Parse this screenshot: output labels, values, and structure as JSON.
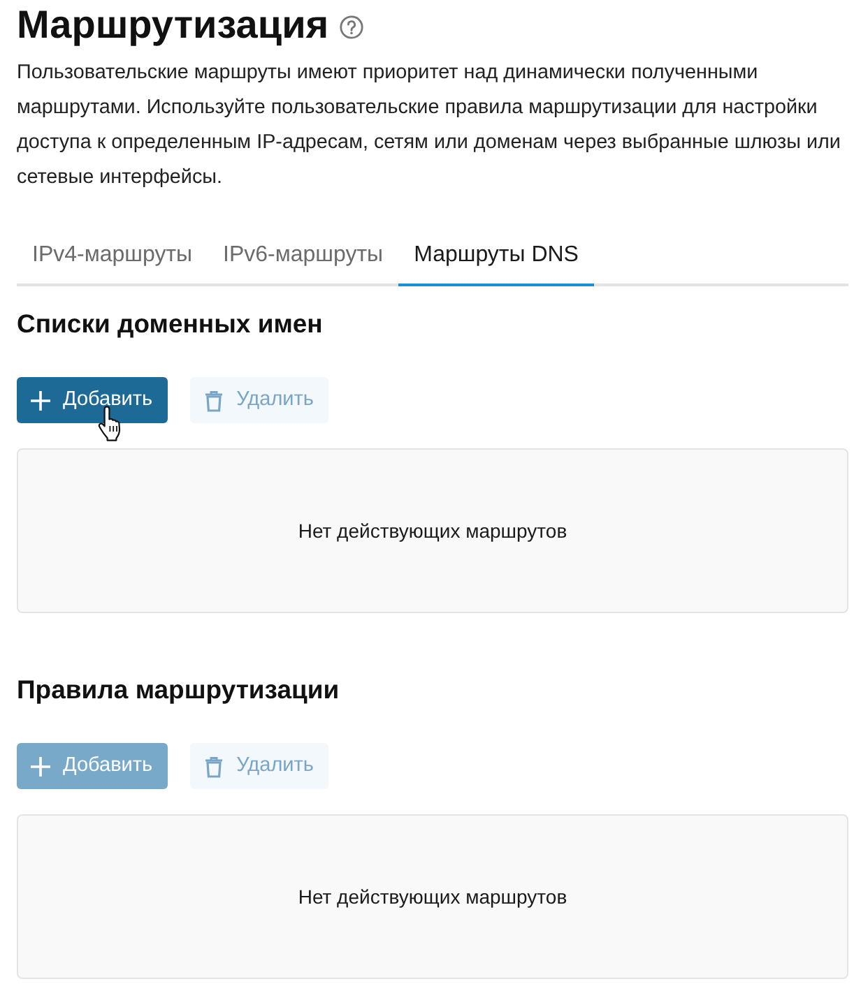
{
  "page": {
    "title": "Маршрутизация",
    "description": "Пользовательские маршруты имеют приоритет над динамически полученными маршрутами. Используйте пользовательские правила маршрутизации для настройки доступа к определенным IP-адресам, сетям или доменам через выбранные шлюзы или сетевые интерфейсы."
  },
  "tabs": [
    {
      "label": "IPv4-маршруты",
      "selected": false
    },
    {
      "label": "IPv6-маршруты",
      "selected": false
    },
    {
      "label": "Маршруты DNS",
      "selected": true
    }
  ],
  "sections": [
    {
      "title": "Списки доменных имен",
      "buttons": [
        {
          "kind": "add",
          "label": "Добавить",
          "disabled": false,
          "hovered": true
        },
        {
          "kind": "delete",
          "label": "Удалить",
          "disabled": true,
          "hovered": false
        }
      ],
      "empty_text": "Нет действующих маршрутов"
    },
    {
      "title": "Правила маршрутизации",
      "buttons": [
        {
          "kind": "add",
          "label": "Добавить",
          "disabled": true,
          "hovered": false
        },
        {
          "kind": "delete",
          "label": "Удалить",
          "disabled": true,
          "hovered": false
        }
      ],
      "empty_text": "Нет действующих маршрутов"
    }
  ]
}
